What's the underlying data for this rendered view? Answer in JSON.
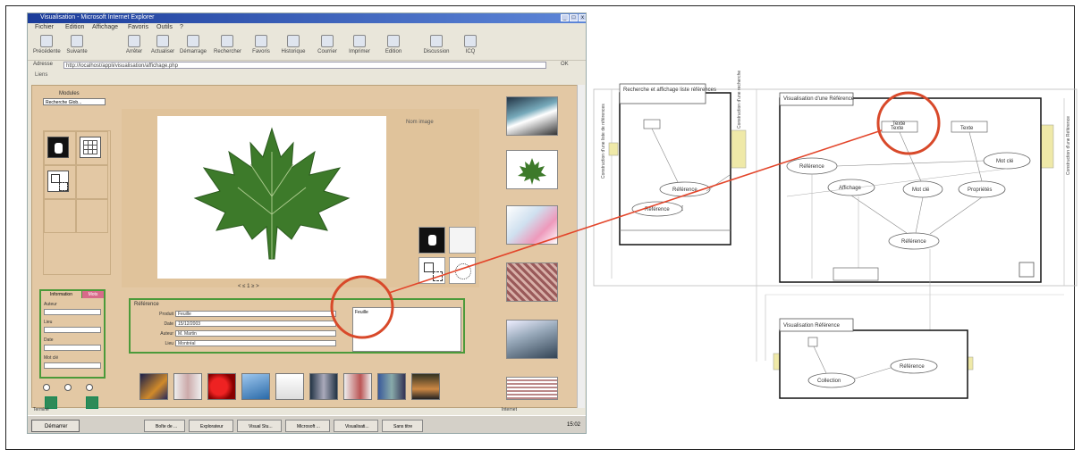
{
  "browser": {
    "title": "Visualisation - Microsoft Internet Explorer",
    "window_buttons": [
      "_",
      "□",
      "x"
    ],
    "menu": [
      "Fichier",
      "Edition",
      "Affichage",
      "Favoris",
      "Outils",
      "?"
    ],
    "toolbar": [
      "Précédente",
      "Suivante",
      "Arrêter",
      "Actualiser",
      "Démarrage",
      "Rechercher",
      "Favoris",
      "Historique",
      "Courrier",
      "Imprimer",
      "Edition",
      "Discussion",
      "ICQ"
    ],
    "address_label": "Adresse",
    "address_value": "http://localhost/appli/visualisation/affichage.php",
    "go_label": "OK",
    "links_label": "Liens"
  },
  "app": {
    "module_label": "Modules",
    "module_select": "Recherche Glob...",
    "viewer_caption": "Nom image",
    "pager": "< ≤ 1 ≥ >",
    "reference_panel": {
      "header": "Référence",
      "fields": [
        {
          "label": "Produit",
          "value": "Feuille"
        },
        {
          "label": "Date",
          "value": "15/12/2003"
        },
        {
          "label": "Auteur",
          "value": "M. Martin"
        },
        {
          "label": "Lieu",
          "value": "Montréal"
        }
      ],
      "note_value": "Feuille"
    },
    "left_form": {
      "tabs": [
        "Information",
        "Mots"
      ],
      "fields": [
        "Auteur",
        "Lieu",
        "Date",
        "Mot clé"
      ]
    },
    "status": "Terminé",
    "zone": "Internet"
  },
  "taskbar": {
    "start": "Démarrer",
    "items": [
      "Boîte de ...",
      "Explorateur",
      "Visual Stu...",
      "Microsoft ...",
      "Visualisati...",
      "Sans titre"
    ],
    "clock": "15:02"
  },
  "diagram": {
    "box_search": "Recherche et affichage liste références",
    "box_visu": "Visualisation d'une Référence",
    "box_small": "Visualisation Référence",
    "vertical_left": "Construction d'une liste de références",
    "vertical_mid": "Construction d'une recherche",
    "vertical_right": "Construction d'une Référence",
    "search_ellipses": [
      "Référence",
      "Référence"
    ],
    "visu_ellipses": [
      "Référence",
      "Affichage",
      "Mot clé",
      "Propriétés",
      "Mot clé",
      "Référence"
    ],
    "visu_rects": [
      "Texte",
      "Texte"
    ],
    "small_ellipses": [
      "Collection",
      "Référence"
    ],
    "highlight_label": "Texte"
  },
  "colors": {
    "highlight_circle": "#d8492a",
    "link_line": "#e3452a",
    "page_bg": "#e3c8a4",
    "panel_border": "#4b9a3a",
    "connector": "#efe9a8"
  }
}
